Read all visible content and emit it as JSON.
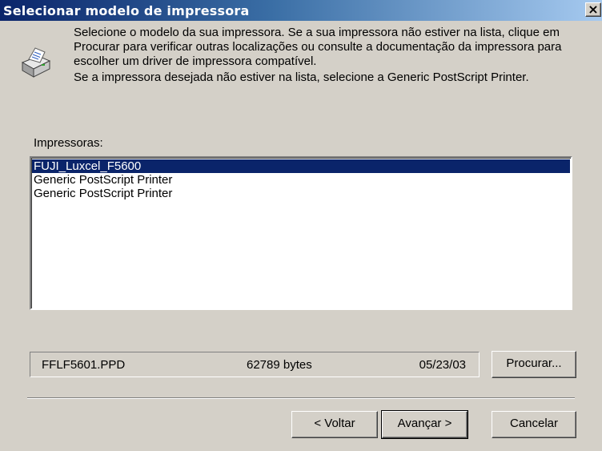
{
  "window": {
    "title": "Selecionar modelo de impressora",
    "close_label": "×"
  },
  "description": {
    "paragraph1": "Selecione o modelo da sua impressora. Se a sua impressora não estiver na lista, clique em Procurar para verificar outras localizações ou consulte a documentação da impressora para escolher um driver de impressora compatível.",
    "paragraph2": "Se a impressora desejada não estiver na lista, selecione a Generic PostScript Printer."
  },
  "printers": {
    "label": "Impressoras:",
    "items": [
      {
        "label": "FUJI_Luxcel_F5600",
        "selected": true
      },
      {
        "label": "Generic PostScript Printer",
        "selected": false
      },
      {
        "label": "Generic PostScript Printer",
        "selected": false
      }
    ]
  },
  "file_info": {
    "filename": "FFLF5601.PPD",
    "size": "62789 bytes",
    "date": "05/23/03"
  },
  "buttons": {
    "browse": "Procurar...",
    "back": "< Voltar",
    "next": "Avançar >",
    "cancel": "Cancelar"
  },
  "colors": {
    "titlebar_start": "#0a246a",
    "titlebar_end": "#a6caf0",
    "selection": "#0a246a",
    "dialog_bg": "#d4d0c8"
  }
}
